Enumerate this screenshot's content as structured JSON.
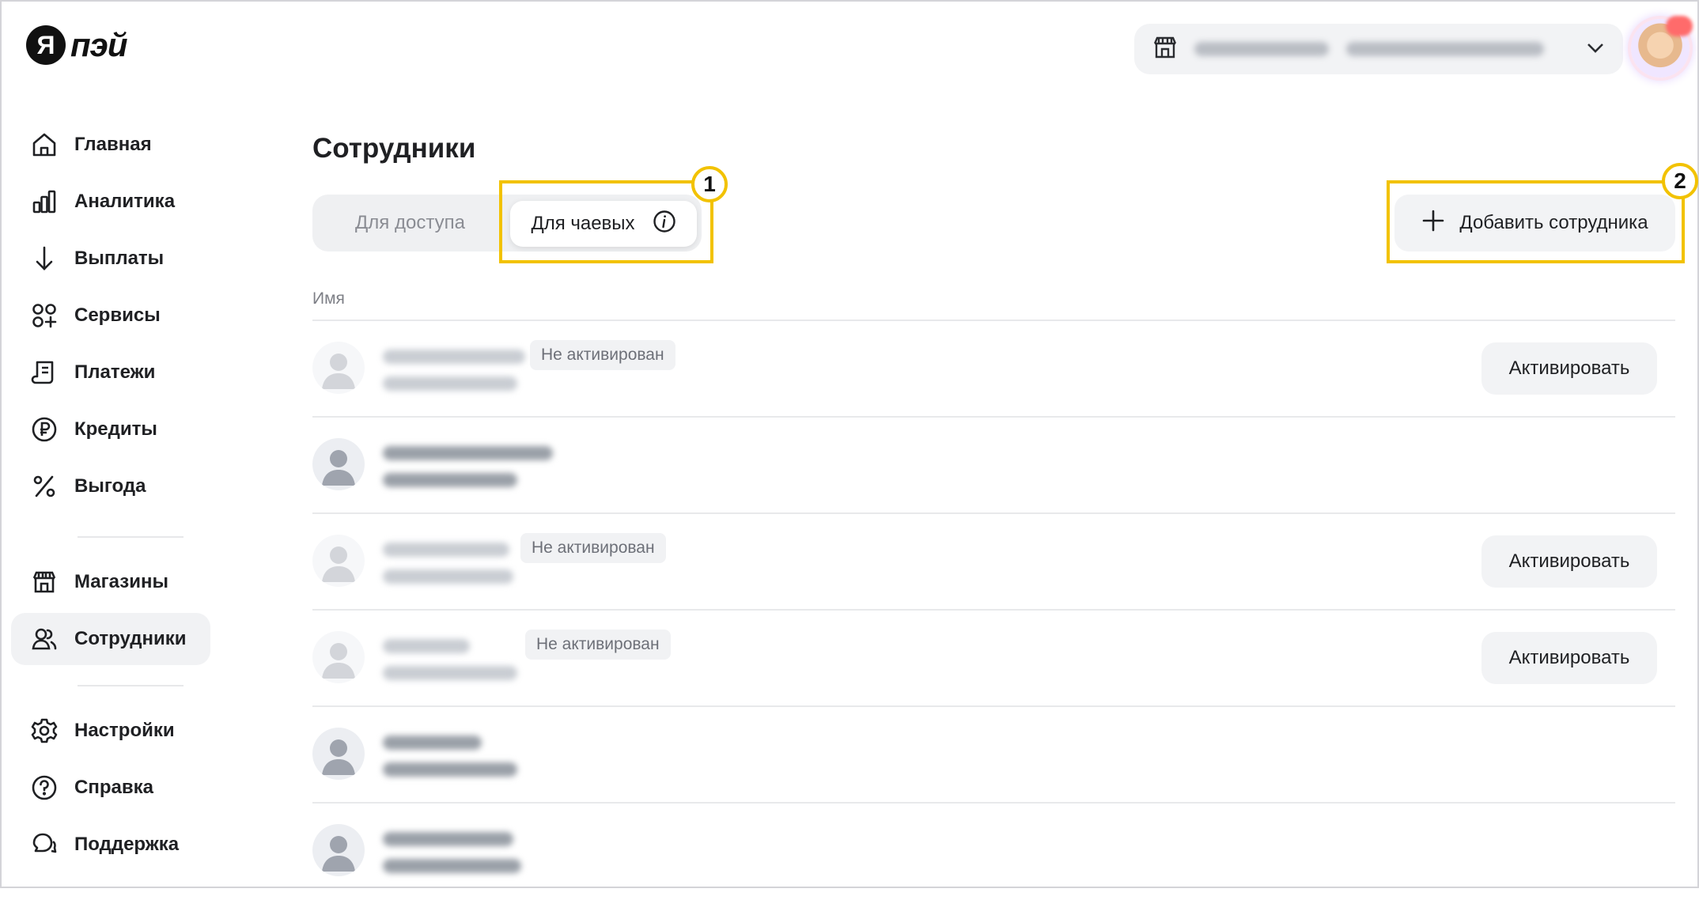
{
  "brand": {
    "logo_mark": "Я",
    "logo_text": "пэй"
  },
  "header": {
    "store_icon": "store-icon",
    "chevron_icon": "chevron-down-icon"
  },
  "sidebar": {
    "items": [
      {
        "label": "Главная",
        "icon": "home-icon"
      },
      {
        "label": "Аналитика",
        "icon": "bar-chart-icon"
      },
      {
        "label": "Выплаты",
        "icon": "arrow-down-icon"
      },
      {
        "label": "Сервисы",
        "icon": "services-icon"
      },
      {
        "label": "Платежи",
        "icon": "receipt-icon"
      },
      {
        "label": "Кредиты",
        "icon": "ruble-circle-icon"
      },
      {
        "label": "Выгода",
        "icon": "percent-icon"
      },
      {
        "label": "Магазины",
        "icon": "store-icon"
      },
      {
        "label": "Сотрудники",
        "icon": "people-icon",
        "active": true
      },
      {
        "label": "Настройки",
        "icon": "gear-icon"
      },
      {
        "label": "Справка",
        "icon": "help-circle-icon"
      },
      {
        "label": "Поддержка",
        "icon": "chat-icon"
      }
    ]
  },
  "main": {
    "title": "Сотрудники",
    "tabs": [
      {
        "label": "Для доступа",
        "selected": false
      },
      {
        "label": "Для чаевых",
        "selected": true,
        "icon": "info-icon"
      }
    ],
    "add_button": {
      "label": "Добавить сотрудника",
      "icon": "plus-icon"
    },
    "callouts": [
      "1",
      "2"
    ],
    "column_header": "Имя",
    "employees": [
      {
        "status": "Не активирован",
        "action": "Активировать",
        "active": false
      },
      {
        "status": "",
        "action": "",
        "active": true
      },
      {
        "status": "Не активирован",
        "action": "Активировать",
        "active": false
      },
      {
        "status": "Не активирован",
        "action": "Активировать",
        "active": false
      },
      {
        "status": "",
        "action": "",
        "active": true
      },
      {
        "status": "",
        "action": "",
        "active": true
      }
    ]
  },
  "colors": {
    "accent_highlight": "#f2c200",
    "active_nav_bg": "#f1f2f4",
    "button_bg": "#f2f3f5",
    "text_primary": "#1f2023",
    "text_muted": "#7d7f86"
  }
}
